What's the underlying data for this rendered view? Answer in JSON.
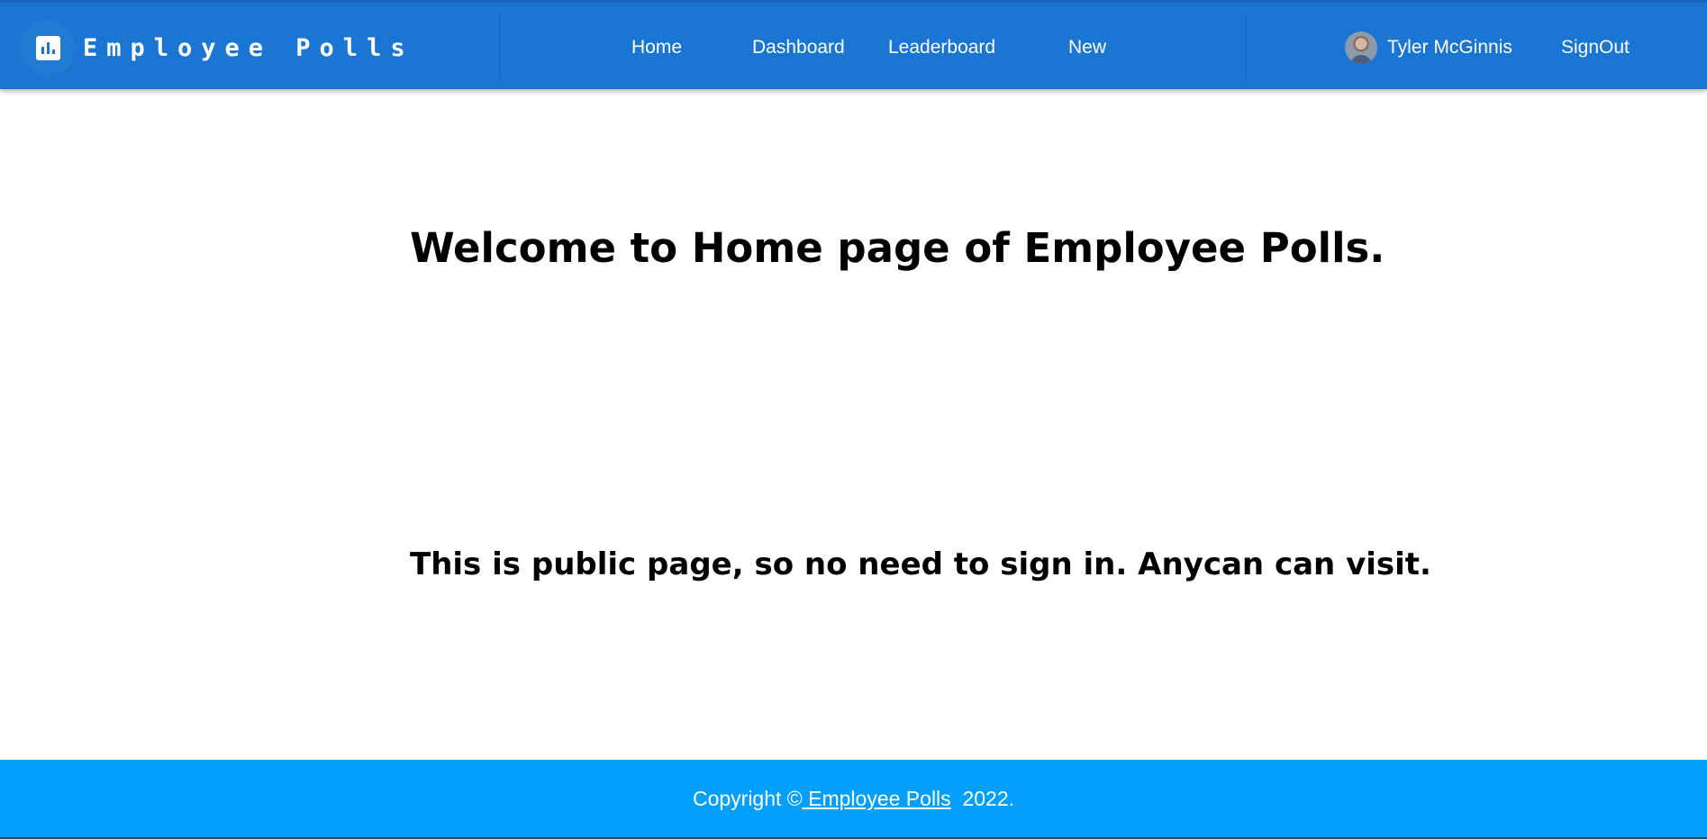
{
  "header": {
    "brand_icon": "bar-chart-icon",
    "title": "Employee Polls",
    "nav": [
      {
        "label": "Home"
      },
      {
        "label": "Dashboard"
      },
      {
        "label": "Leaderboard"
      },
      {
        "label": "New"
      }
    ],
    "user": {
      "name": "Tyler McGinnis",
      "avatar": "user-avatar"
    },
    "signout_label": "SignOut"
  },
  "main": {
    "heading": "Welcome to Home page of Employee Polls.",
    "subheading": "This is public page, so no need to sign in. Anycan can visit."
  },
  "footer": {
    "prefix": "Copyright ©",
    "link_text": " Employee Polls",
    "suffix": "  2022."
  },
  "colors": {
    "app_bar": "#1a76d2",
    "footer": "#03a0fb",
    "text_on_bar": "#ffffff"
  }
}
